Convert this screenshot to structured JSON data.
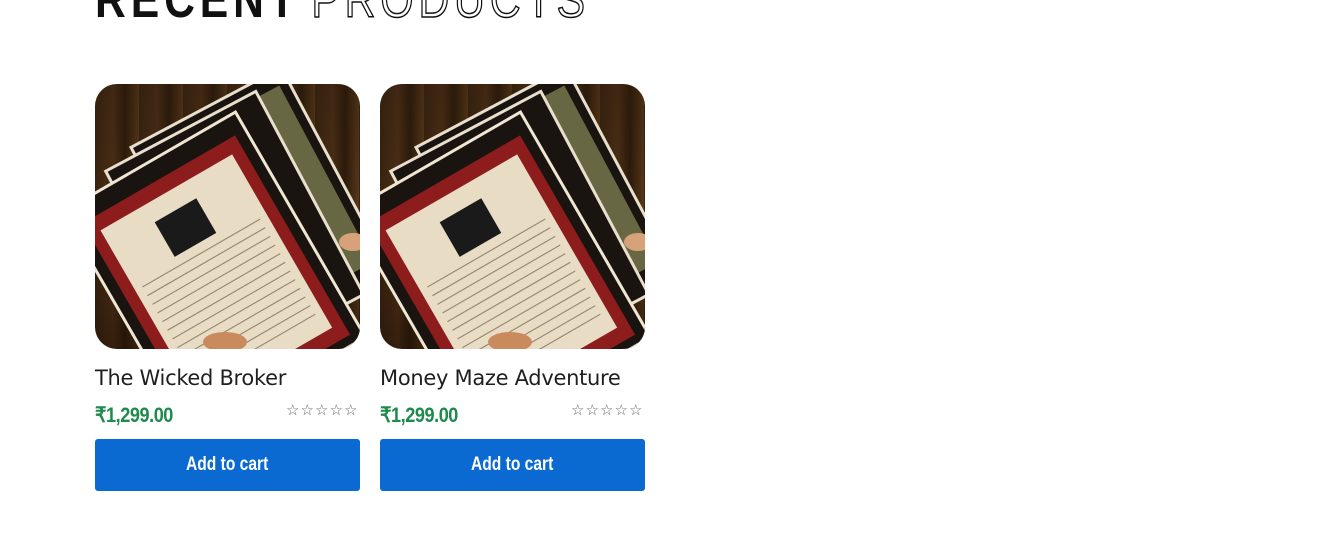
{
  "section": {
    "title_word1": "RECENT",
    "title_word2": "PRODUCTS"
  },
  "products": [
    {
      "name": "The Wicked Broker",
      "price": "₹1,299.00",
      "rating_stars": 5,
      "rating_value": 0,
      "button_label": "Add to cart",
      "image_icon": "product-photo"
    },
    {
      "name": "Money Maze Adventure",
      "price": "₹1,299.00",
      "rating_stars": 5,
      "rating_value": 0,
      "button_label": "Add to cart",
      "image_icon": "product-photo"
    }
  ],
  "colors": {
    "price": "#1e8a4c",
    "button": "#0a6ad2",
    "text": "#1f1f1f"
  }
}
